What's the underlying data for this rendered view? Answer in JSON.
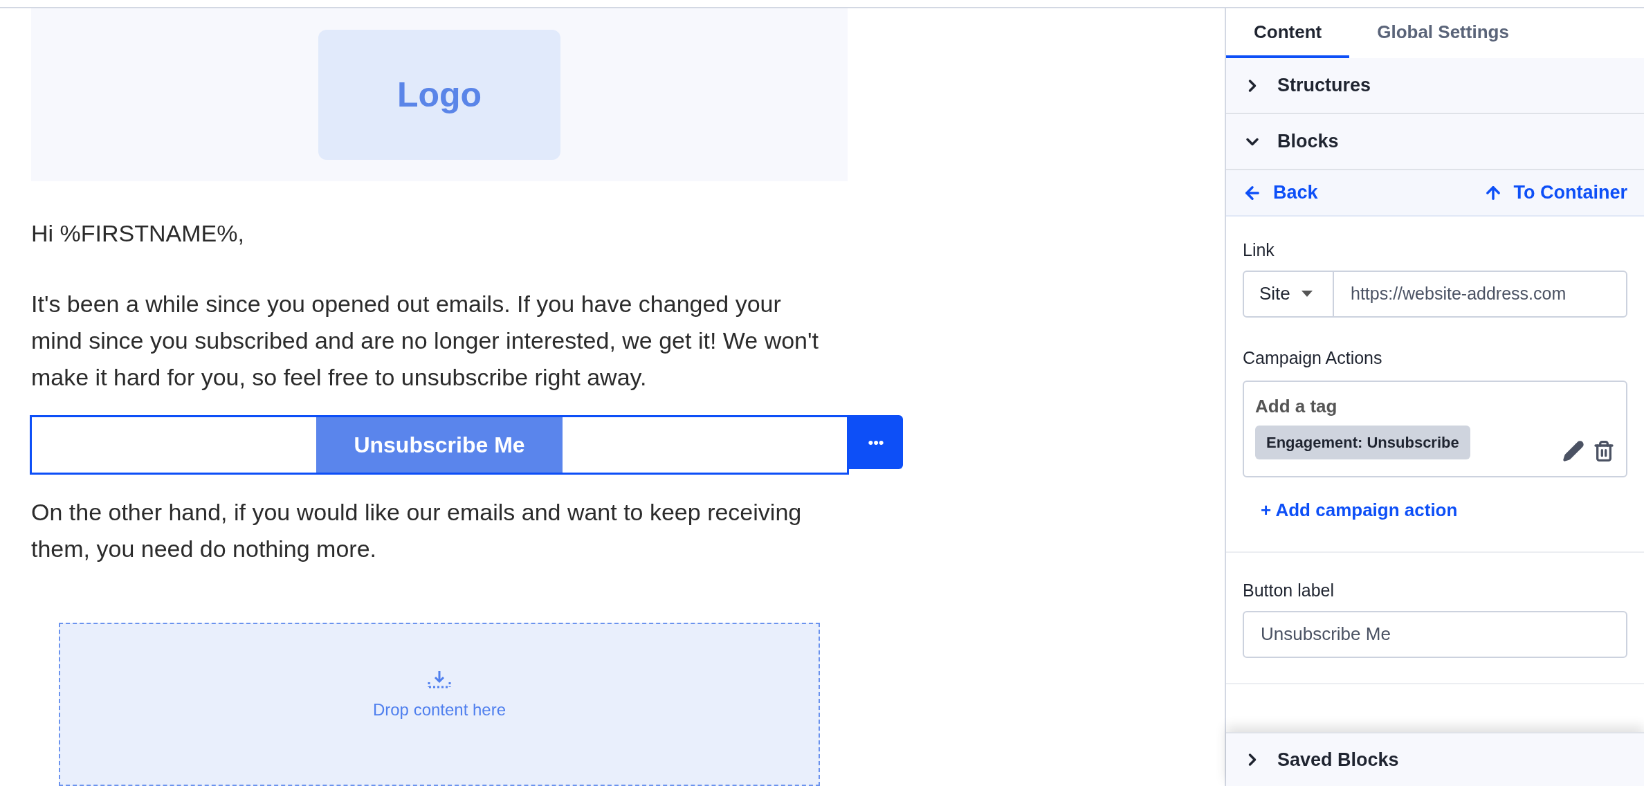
{
  "email": {
    "logo": "Logo",
    "greeting": "Hi %FIRSTNAME%,",
    "paragraphs": [
      "It's been a while since you opened out emails. If you have changed your mind since you subscribed and are no longer interested, we get it! We won't make it hard for you, so feel free to unsubscribe right away.",
      "On the other hand, if you would like our emails and want to keep receiving them, you need do nothing more."
    ],
    "button": {
      "label": "Unsubscribe Me",
      "selected": true
    },
    "more_button": "•••",
    "drop_zone": "Drop content here"
  },
  "panel": {
    "tabs": [
      {
        "label": "Content",
        "selected": true
      },
      {
        "label": "Global Settings",
        "selected": false
      }
    ],
    "sections": [
      {
        "label": "Structures",
        "expanded": false
      },
      {
        "label": "Blocks",
        "expanded": true
      }
    ],
    "back": "Back",
    "to_container": "To Container",
    "link": {
      "label": "Link",
      "type": "Site",
      "value": "https://website-address.com"
    },
    "campaign_actions": {
      "label": "Campaign Actions",
      "title": "Add a tag",
      "tag": "Engagement: Unsubscribe",
      "add": "+ Add campaign action"
    },
    "button_label": {
      "label": "Button label",
      "value": "Unsubscribe Me"
    },
    "footer_section": {
      "label": "Saved Blocks",
      "expanded": false
    }
  }
}
